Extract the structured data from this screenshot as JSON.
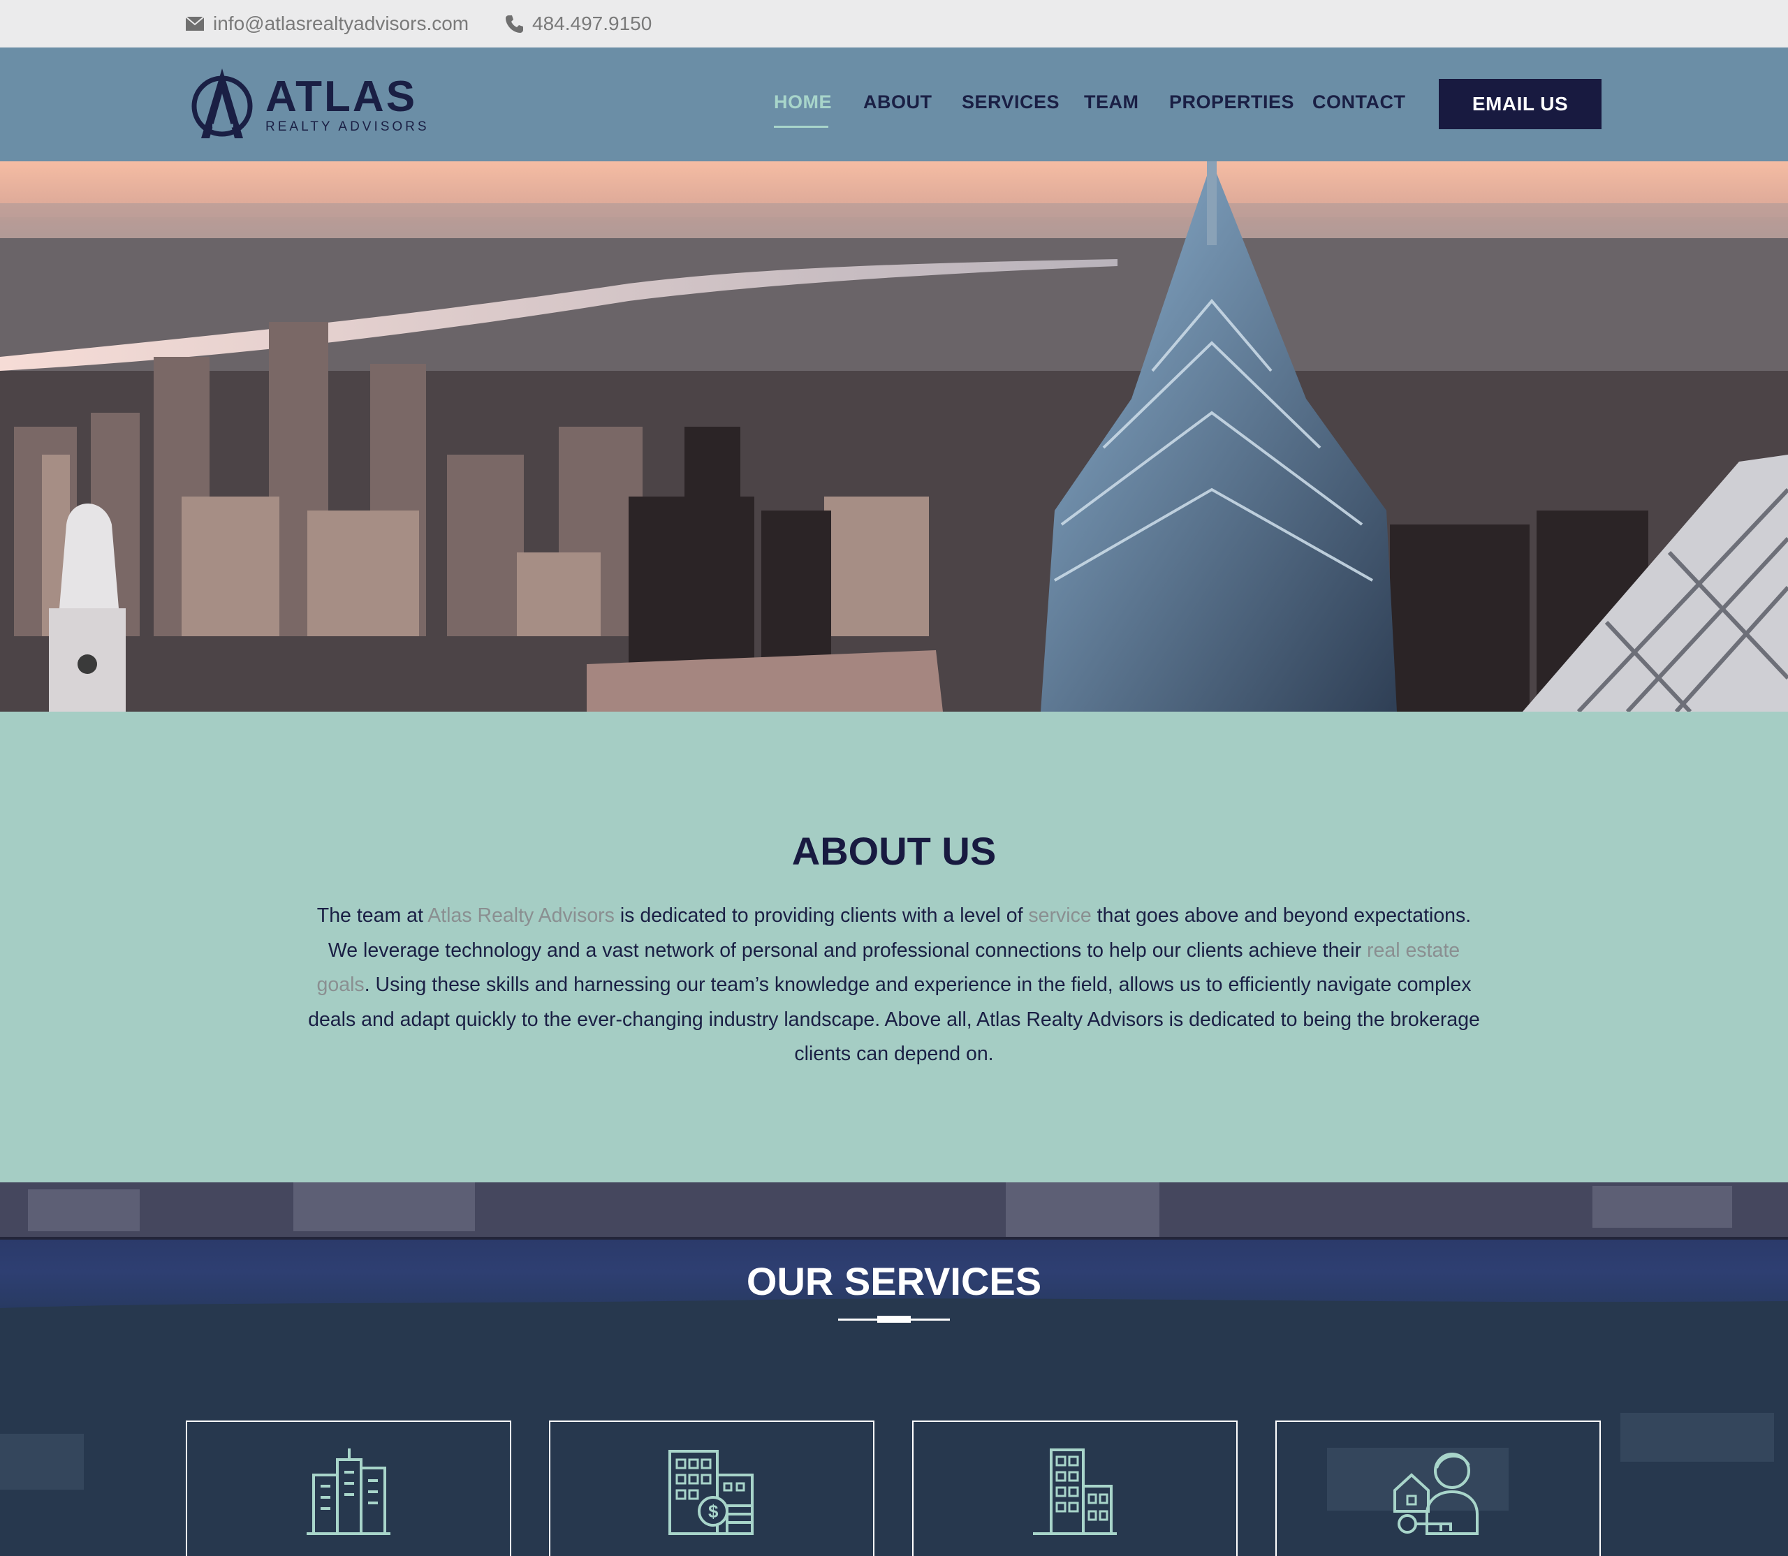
{
  "topbar": {
    "email": "info@atlasrealtyadvisors.com",
    "phone": "484.497.9150",
    "email_icon": "envelope-icon",
    "phone_icon": "phone-icon"
  },
  "header": {
    "logo_word": "ATLAS",
    "logo_sub": "REALTY ADVISORS",
    "nav": [
      "HOME",
      "ABOUT",
      "SERVICES",
      "TEAM",
      "PROPERTIES",
      "CONTACT"
    ],
    "active_nav": "HOME",
    "cta_label": "EMAIL US"
  },
  "about": {
    "title_bold": "ABOUT",
    "title_rest": " US",
    "p1": "The team at ",
    "link1": "Atlas Realty Advisors",
    "p2": " is dedicated to providing clients with a level of ",
    "link2": "service",
    "p3": " that goes above and beyond expectations. We leverage technology and a vast network of personal and professional connections to help our clients achieve their ",
    "link3": "real estate goals",
    "p4": ". Using these skills and harnessing our team’s knowledge and experience in the field, allows us to efficiently navigate complex deals and adapt quickly to the ever-changing industry landscape. Above all, Atlas Realty Advisors is dedicated to being the brokerage clients can depend on."
  },
  "services": {
    "title_light": "OUR ",
    "title_bold": "SERVICES",
    "cards": [
      {
        "icon": "office-buildings-icon"
      },
      {
        "icon": "building-money-icon"
      },
      {
        "icon": "tall-building-icon"
      },
      {
        "icon": "agent-house-key-icon"
      }
    ]
  },
  "colors": {
    "navy": "#181a40",
    "header_bg": "#6b8ea6",
    "mint": "#a5cdc4",
    "accent": "#a8d5ca"
  }
}
